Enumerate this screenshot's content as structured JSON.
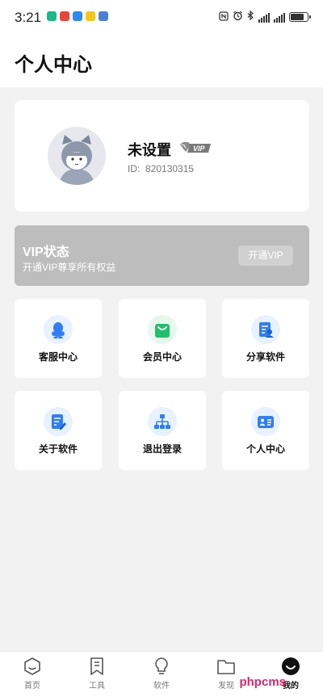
{
  "status_bar": {
    "time": "3:21",
    "notification_icons": [
      "download-app-icon",
      "mail-app-icon",
      "cloud-app-icon",
      "news-app-icon",
      "archive-app-icon"
    ],
    "system_icons": [
      "nfc-icon",
      "alarm-icon",
      "bluetooth-icon",
      "signal-icon",
      "signal-icon",
      "battery-icon"
    ]
  },
  "header": {
    "title": "个人中心"
  },
  "profile": {
    "name": "未设置",
    "vip_badge_text": "VIP",
    "id_label": "ID:",
    "id_value": "820130315"
  },
  "vip": {
    "title": "VIP状态",
    "subtitle": "开通VIP尊享所有权益",
    "button": "开通VIP"
  },
  "tiles": [
    {
      "label": "客服中心",
      "icon": "qq-penguin-icon",
      "color": "#2f7ef5"
    },
    {
      "label": "会员中心",
      "icon": "shopping-bag-icon",
      "color": "#1fbf6b"
    },
    {
      "label": "分享软件",
      "icon": "share-document-icon",
      "color": "#2f7ef5"
    },
    {
      "label": "关于软件",
      "icon": "document-edit-icon",
      "color": "#2f7ef5"
    },
    {
      "label": "退出登录",
      "icon": "network-tree-icon",
      "color": "#2f7ef5"
    },
    {
      "label": "个人中心",
      "icon": "id-card-icon",
      "color": "#2f7ef5"
    }
  ],
  "bottom_nav": [
    {
      "label": "首页",
      "icon": "home-hexagon-icon"
    },
    {
      "label": "工具",
      "icon": "bookmark-icon"
    },
    {
      "label": "软件",
      "icon": "lightbulb-icon"
    },
    {
      "label": "发现",
      "icon": "folder-icon"
    },
    {
      "label": "我的",
      "icon": "profile-smile-icon",
      "active": true
    }
  ],
  "watermark": "phpcms",
  "colors": {
    "accent_blue": "#2f7ef5",
    "accent_green": "#1fbf6b",
    "vip_card_bg": "#bdbdbd",
    "page_bg": "#f2f2f2"
  }
}
